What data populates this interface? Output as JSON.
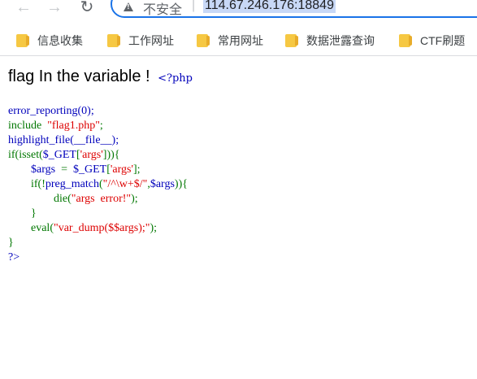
{
  "browser": {
    "security_label": "不安全",
    "separator": "|",
    "url": "114.67.246.176:18849"
  },
  "bookmarks": [
    {
      "label": "信息收集"
    },
    {
      "label": "工作网址"
    },
    {
      "label": "常用网址"
    },
    {
      "label": "数据泄露查询"
    },
    {
      "label": "CTF刷题"
    }
  ],
  "page": {
    "heading": "flag In the variable ! ",
    "php_open": "<?php",
    "code": {
      "l1": "error_reporting(0);",
      "l2_kw": "include  ",
      "l2_str": "\"flag1.php\"",
      "l2_end": ";",
      "l3": "highlight_file(__file__);",
      "l4_a": "if(isset(",
      "l4_var": "$_GET",
      "l4_b": "[",
      "l4_str": "'args'",
      "l4_c": "])){",
      "l5_var1": "$args",
      "l5_eq": "  =  ",
      "l5_var2": "$_GET",
      "l5_b": "[",
      "l5_str": "'args'",
      "l5_c": "];",
      "l6_a": "if(!",
      "l6_fn": "preg_match",
      "l6_b": "(",
      "l6_str": "\"/^\\w+$/\"",
      "l6_c": ",",
      "l6_var": "$args",
      "l6_d": ")){",
      "l7_a": "die(",
      "l7_str": "\"args  error!\"",
      "l7_b": ");",
      "l8": "}",
      "l9_a": "eval(",
      "l9_str": "\"var_dump($$args);\"",
      "l9_b": ");",
      "l10": "}",
      "l11": "?>"
    }
  }
}
